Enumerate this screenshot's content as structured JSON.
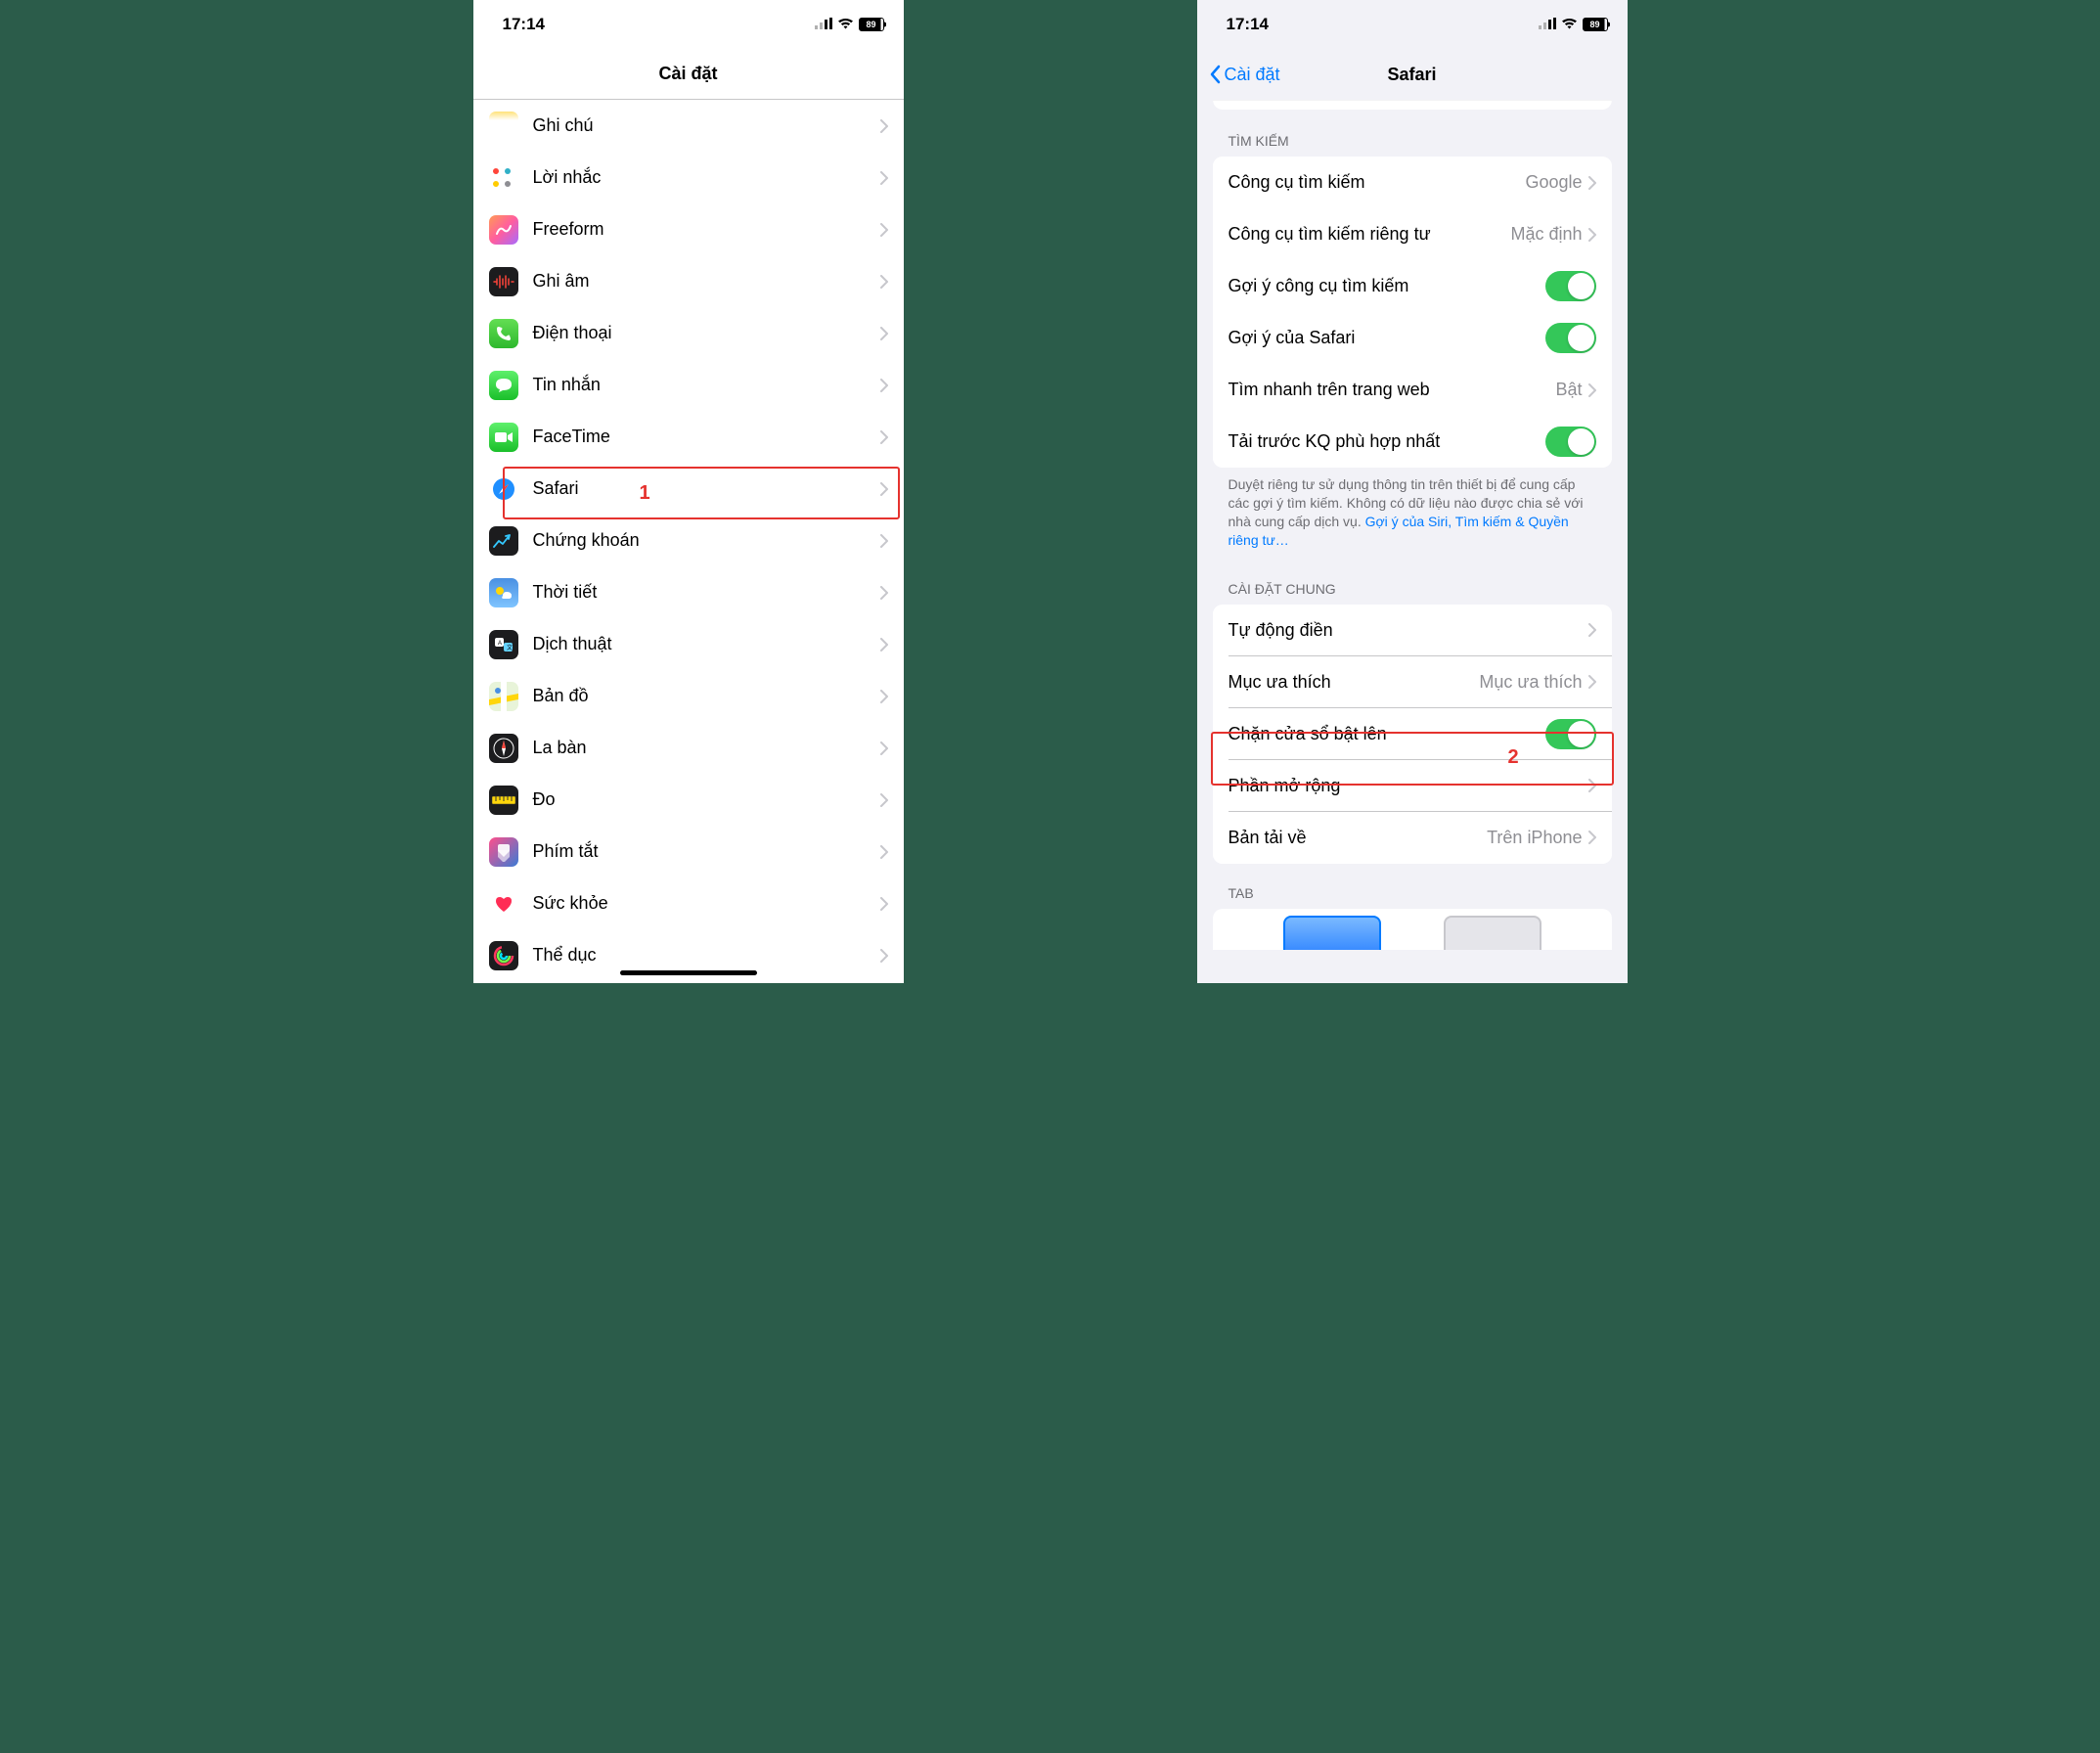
{
  "status": {
    "time": "17:14",
    "battery": "89"
  },
  "left": {
    "title": "Cài đặt",
    "annotation": "1",
    "items": [
      {
        "name": "notes",
        "label": "Ghi chú"
      },
      {
        "name": "reminders",
        "label": "Lời nhắc"
      },
      {
        "name": "freeform",
        "label": "Freeform"
      },
      {
        "name": "voice-memos",
        "label": "Ghi âm"
      },
      {
        "name": "phone",
        "label": "Điện thoại"
      },
      {
        "name": "messages",
        "label": "Tin nhắn"
      },
      {
        "name": "facetime",
        "label": "FaceTime"
      },
      {
        "name": "safari",
        "label": "Safari"
      },
      {
        "name": "stocks",
        "label": "Chứng khoán"
      },
      {
        "name": "weather",
        "label": "Thời tiết"
      },
      {
        "name": "translate",
        "label": "Dịch thuật"
      },
      {
        "name": "maps",
        "label": "Bản đồ"
      },
      {
        "name": "compass",
        "label": "La bàn"
      },
      {
        "name": "measure",
        "label": "Đo"
      },
      {
        "name": "shortcuts",
        "label": "Phím tắt"
      },
      {
        "name": "health",
        "label": "Sức khỏe"
      },
      {
        "name": "fitness",
        "label": "Thể dục"
      }
    ]
  },
  "right": {
    "back": "Cài đặt",
    "title": "Safari",
    "annotation": "2",
    "sections": {
      "search": {
        "header": "TÌM KIẾM",
        "rows": [
          {
            "name": "search-engine",
            "label": "Công cụ tìm kiếm",
            "value": "Google",
            "type": "link"
          },
          {
            "name": "private-search-engine",
            "label": "Công cụ tìm kiếm riêng tư",
            "value": "Mặc định",
            "type": "link"
          },
          {
            "name": "search-engine-suggestions",
            "label": "Gợi ý công cụ tìm kiếm",
            "type": "toggle",
            "on": true
          },
          {
            "name": "safari-suggestions",
            "label": "Gợi ý của Safari",
            "type": "toggle",
            "on": true
          },
          {
            "name": "quick-website-search",
            "label": "Tìm nhanh trên trang web",
            "value": "Bật",
            "type": "link"
          },
          {
            "name": "preload-top-hit",
            "label": "Tải trước KQ phù hợp nhất",
            "type": "toggle",
            "on": true
          }
        ],
        "footer": "Duyệt riêng tư sử dụng thông tin trên thiết bị để cung cấp các gợi ý tìm kiếm. Không có dữ liệu nào được chia sẻ với nhà cung cấp dịch vụ. ",
        "footer_link": "Gợi ý của Siri, Tìm kiếm & Quyền riêng tư…"
      },
      "general": {
        "header": "CÀI ĐẶT CHUNG",
        "rows": [
          {
            "name": "autofill",
            "label": "Tự động điền",
            "type": "link"
          },
          {
            "name": "favorites",
            "label": "Mục ưa thích",
            "value": "Mục ưa thích",
            "type": "link"
          },
          {
            "name": "block-popups",
            "label": "Chặn cửa sổ bật lên",
            "type": "toggle",
            "on": true
          },
          {
            "name": "extensions",
            "label": "Phần mở rộng",
            "type": "link"
          },
          {
            "name": "downloads",
            "label": "Bản tải về",
            "value": "Trên iPhone",
            "type": "link"
          }
        ]
      },
      "tab": {
        "header": "TAB"
      }
    }
  }
}
